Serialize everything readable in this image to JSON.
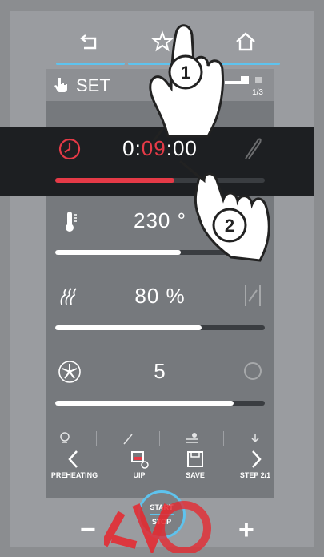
{
  "header": {
    "nav": [
      {
        "name": "back",
        "icon": "back-arrow-icon"
      },
      {
        "name": "favorite",
        "icon": "star-icon"
      },
      {
        "name": "home",
        "icon": "home-icon"
      }
    ]
  },
  "set_panel": {
    "label": "SET",
    "page_indicator": "1/3"
  },
  "timer": {
    "hours": "0:",
    "minutes": "09",
    "seconds": ":00",
    "progress": 0.57,
    "accent": "#e53a47"
  },
  "temperature": {
    "value": "230 °",
    "progress": 0.6
  },
  "humidity": {
    "value": "80 %",
    "progress": 0.7
  },
  "fan": {
    "value": "5",
    "progress": 0.85
  },
  "actions": {
    "preheating": "PREHEATING",
    "uip": "UIP",
    "save": "SAVE",
    "step": "STEP 2/1"
  },
  "controls": {
    "minus": "−",
    "plus": "+",
    "start": "START",
    "stop": "STOP"
  },
  "callouts": {
    "one": "1",
    "two": "2"
  },
  "colors": {
    "accent_blue": "#5ec3ee",
    "accent_red": "#e53a47"
  }
}
